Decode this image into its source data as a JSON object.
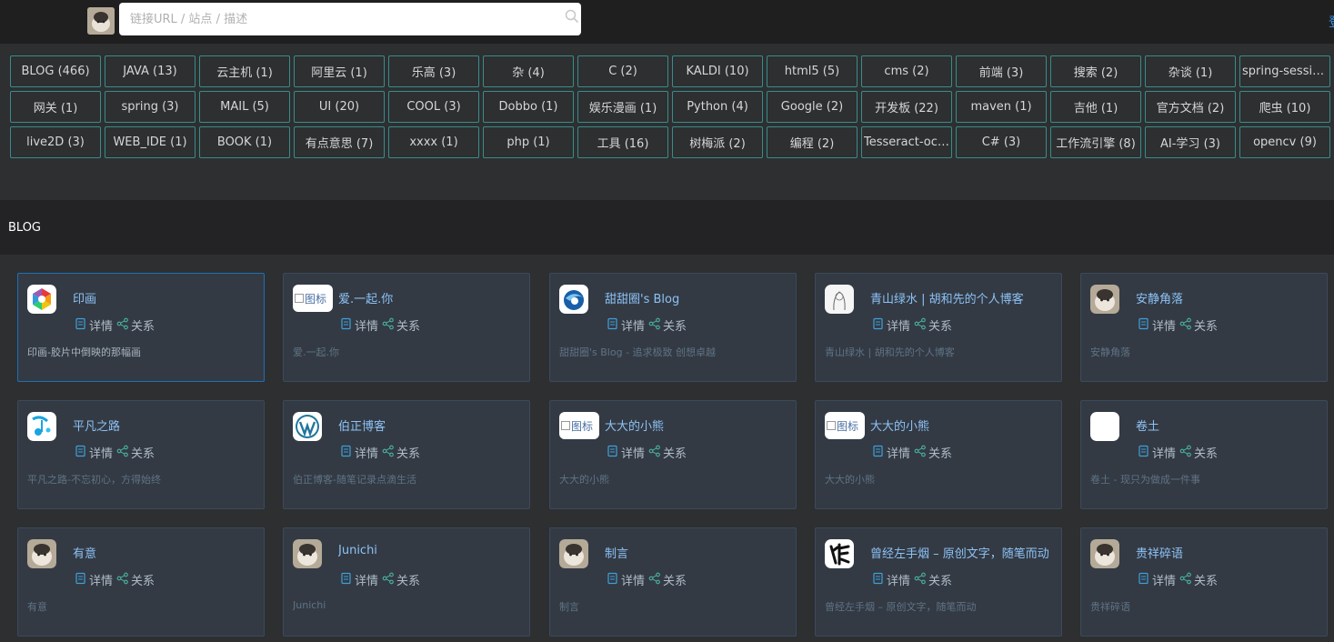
{
  "search": {
    "placeholder": "链接URL / 站点 / 描述"
  },
  "top_right_text": "登",
  "tags": [
    "BLOG (466)",
    "JAVA (13)",
    "云主机 (1)",
    "阿里云 (1)",
    "乐高 (3)",
    "杂 (4)",
    "C (2)",
    "KALDI (10)",
    "html5 (5)",
    "cms (2)",
    "前端 (3)",
    "搜索 (2)",
    "杂谈 (1)",
    "spring-session...",
    "网关 (1)",
    "spring (3)",
    "MAIL (5)",
    "UI (20)",
    "COOL (3)",
    "Dobbo (1)",
    "娱乐漫画 (1)",
    "Python (4)",
    "Google (2)",
    "开发板 (22)",
    "maven (1)",
    "吉他 (1)",
    "官方文档 (2)",
    "爬虫 (10)",
    "live2D (3)",
    "WEB_IDE (1)",
    "BOOK (1)",
    "有点意思 (7)",
    "xxxx (1)",
    "php (1)",
    "工具 (16)",
    "树梅派 (2)",
    "编程 (2)",
    "Tesseract-ocr ...",
    "C# (3)",
    "工作流引擎 (8)",
    "AI-学习 (3)",
    "opencv (9)"
  ],
  "section_title": "BLOG",
  "card_labels": {
    "detail": "详情",
    "relation": "关系",
    "broken_icon_alt": "图标"
  },
  "cards": [
    {
      "title": "印画",
      "desc": "印画-胶片中倒映的那幅画",
      "icon": "rainbow-aperture-icon"
    },
    {
      "title": "爱.一起.你",
      "desc": "爱.一起.你",
      "icon": "broken-image-icon"
    },
    {
      "title": "甜甜圈's Blog",
      "desc": "甜甜圈's Blog - 追求极致 创想卓越",
      "icon": "blue-swirl-logo-icon"
    },
    {
      "title": "青山绿水 | 胡和先的个人博客",
      "desc": "青山绿水 | 胡和先的个人博客",
      "icon": "sketch-portrait-icon"
    },
    {
      "title": "安静角落",
      "desc": "安静角落",
      "icon": "cat-avatar-icon"
    },
    {
      "title": "平凡之路",
      "desc": "平凡之路-不忘初心，方得始终",
      "icon": "music-note-icon"
    },
    {
      "title": "伯正博客",
      "desc": "伯正博客-随笔记录点滴生活",
      "icon": "wordpress-icon"
    },
    {
      "title": "大大的小熊",
      "desc": "大大的小熊",
      "icon": "broken-image-icon"
    },
    {
      "title": "大大的小熊",
      "desc": "大大的小熊",
      "icon": "broken-image-icon"
    },
    {
      "title": "卷土",
      "desc": "卷土 - 现只为做成一件事",
      "icon": "blank-white-icon"
    },
    {
      "title": "有意",
      "desc": "有意",
      "icon": "cat-avatar-icon"
    },
    {
      "title": "Junichi",
      "desc": "Junichi",
      "icon": "cat-avatar-icon"
    },
    {
      "title": "制言",
      "desc": "制言",
      "icon": "cat-avatar-icon"
    },
    {
      "title": "曾经左手烟 – 原创文字，随笔而动",
      "desc": "曾经左手烟 – 原创文字，随笔而动",
      "icon": "calligraphy-icon"
    },
    {
      "title": "贵祥碎语",
      "desc": "贵祥碎语",
      "icon": "cat-avatar-icon"
    }
  ]
}
